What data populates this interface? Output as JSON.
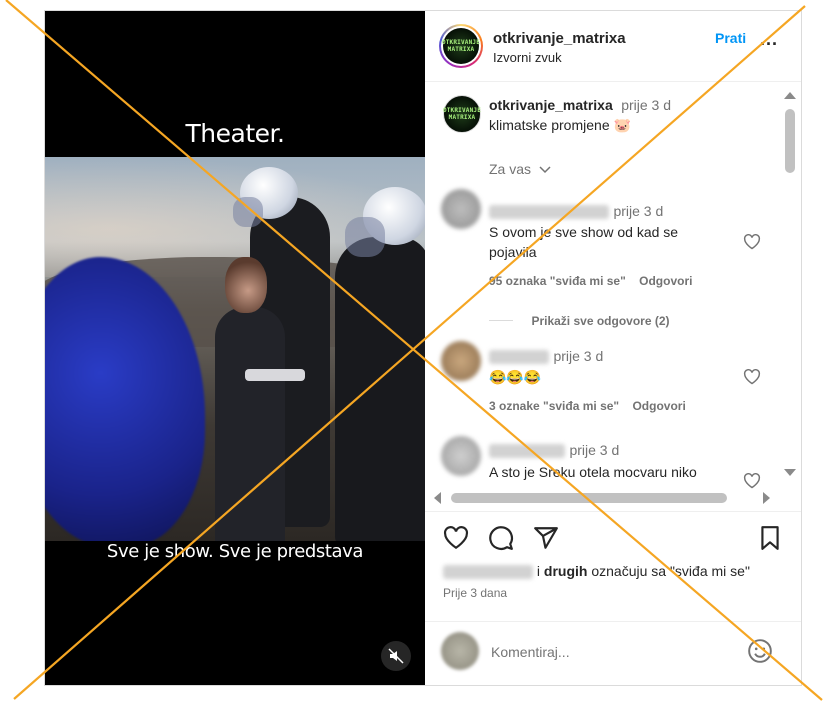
{
  "video": {
    "caption_top": "Theater.",
    "caption_bottom": "Sve je show. Sve je predstava",
    "mute_icon": "speaker-muted-icon"
  },
  "header": {
    "username": "otkrivanje_matrixa",
    "subtitle": "Izvorni zvuk",
    "follow_label": "Prati",
    "more_label": "...",
    "avatar_text": "OTKRIVANJE MATRIXA"
  },
  "post": {
    "username": "otkrivanje_matrixa",
    "time": "prije 3 d",
    "text": "klimatske promjene",
    "emoji": "🐷"
  },
  "filter_label": "Za vas",
  "comments": [
    {
      "time": "prije 3 d",
      "text": "S ovom je sve show od kad se pojavila",
      "likes": "95 oznaka \"sviđa mi se\"",
      "reply": "Odgovori",
      "view_replies": "Prikaži sve odgovore (2)"
    },
    {
      "time": "prije 3 d",
      "text": "😂😂😂",
      "likes": "3 oznake \"sviđa mi se\"",
      "reply": "Odgovori"
    },
    {
      "time": "prije 3 d",
      "text": "A sto je Sreku otela mocvaru niko"
    }
  ],
  "likes_line": {
    "connector": "i",
    "others": "drugih",
    "suffix": "označuju sa \"sviđa mi se\""
  },
  "post_time": "Prije 3 dana",
  "comment_input": {
    "placeholder": "Komentiraj..."
  },
  "colors": {
    "accent_blue": "#0095f6",
    "cross_lines": "#f5a623",
    "text_gray": "#737373"
  }
}
